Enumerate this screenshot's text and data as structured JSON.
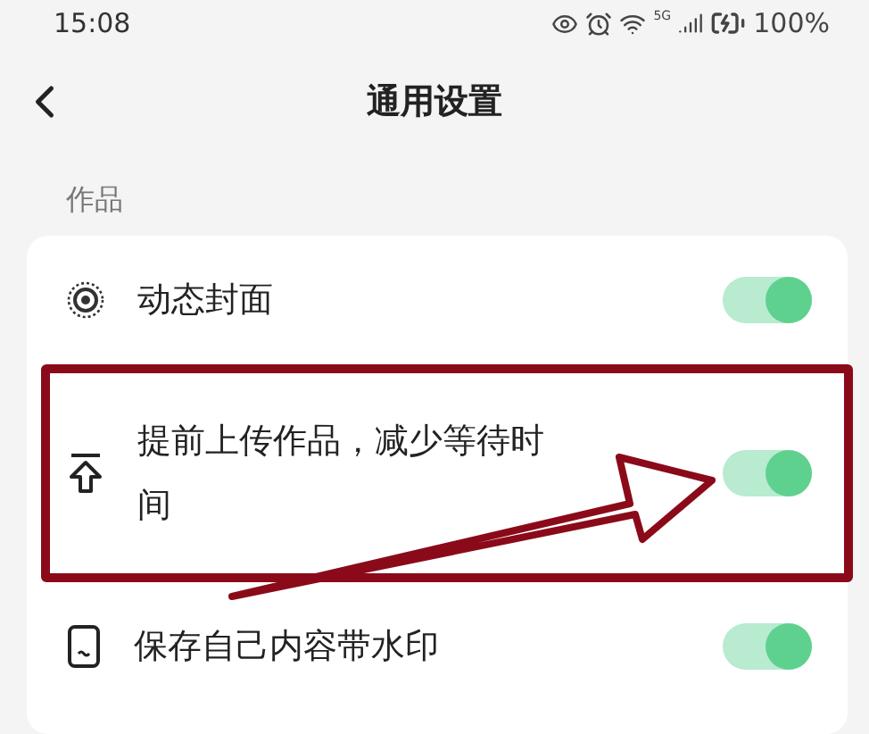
{
  "status_bar": {
    "time": "15:08",
    "network": "5G",
    "battery": "100%"
  },
  "header": {
    "title": "通用设置"
  },
  "section": {
    "label": "作品"
  },
  "settings": [
    {
      "kind": "cover",
      "label": "动态封面",
      "on": true,
      "highlighted": false
    },
    {
      "kind": "upload",
      "label": "提前上传作品，减少等待时间",
      "on": true,
      "highlighted": true
    },
    {
      "kind": "watermark",
      "label": "保存自己内容带水印",
      "on": true,
      "highlighted": false
    }
  ]
}
